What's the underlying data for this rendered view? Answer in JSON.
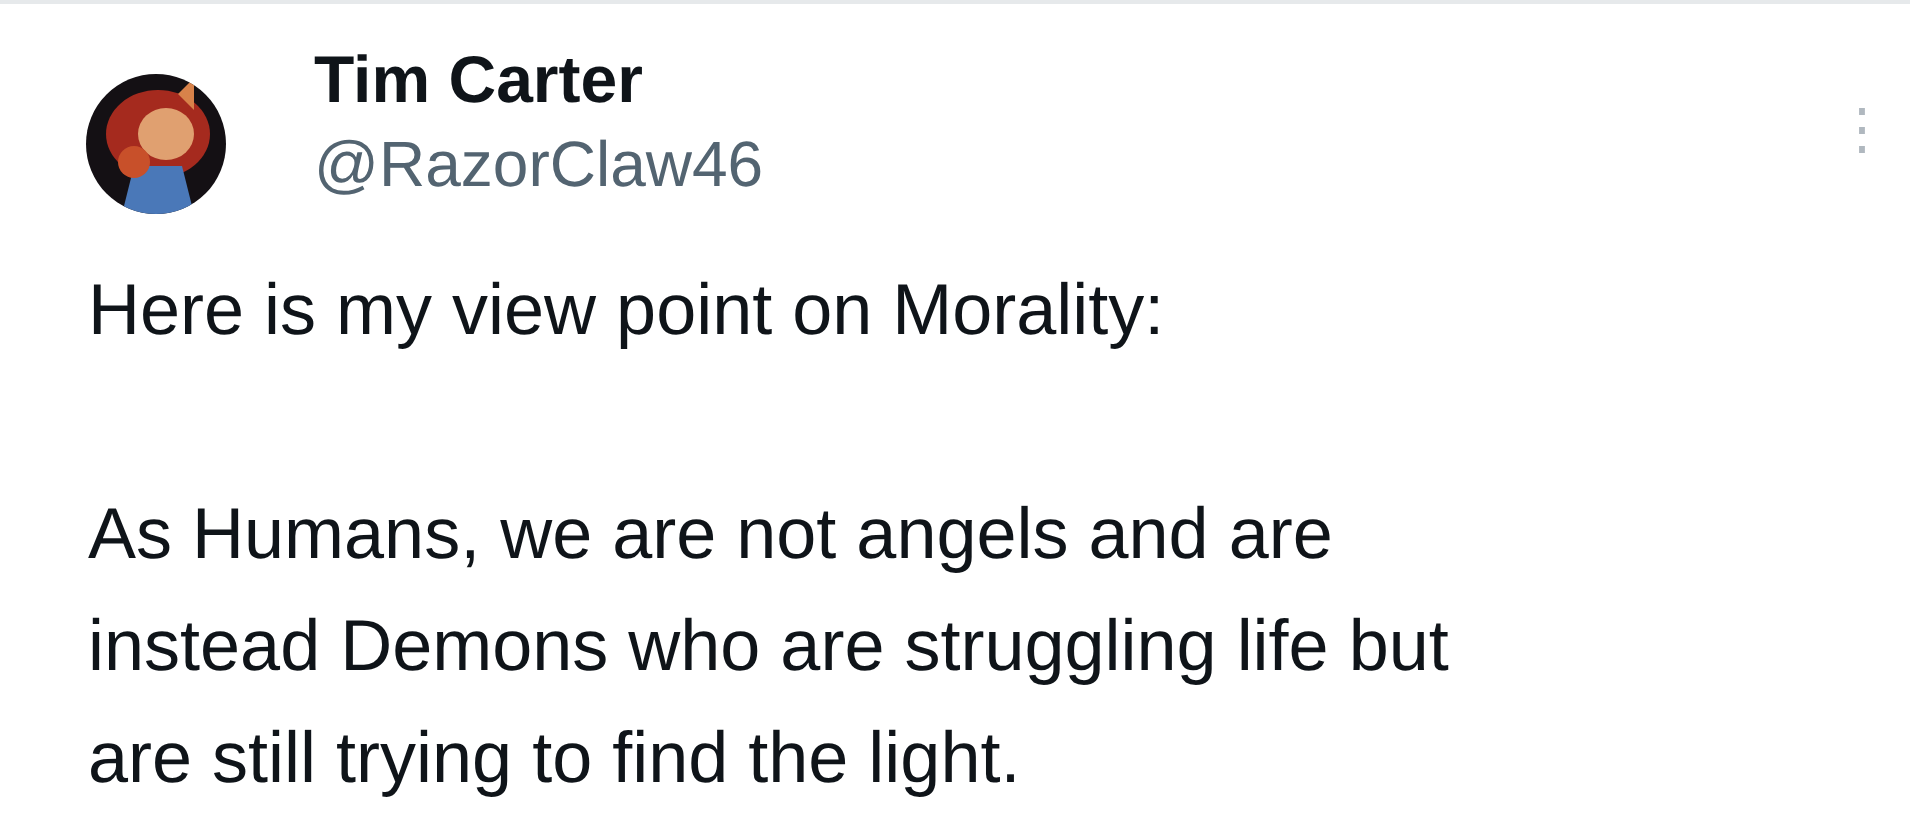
{
  "post": {
    "author_name": "Tim Carter",
    "handle": "@RazorClaw46",
    "more_icon": "⋮",
    "paragraphs": [
      {
        "lines": [
          "Here is my view point on Morality:"
        ]
      },
      {
        "lines": [
          "As Humans, we are not angels and are",
          "instead Demons who are struggling life but",
          "are still trying to find the light."
        ]
      }
    ]
  }
}
